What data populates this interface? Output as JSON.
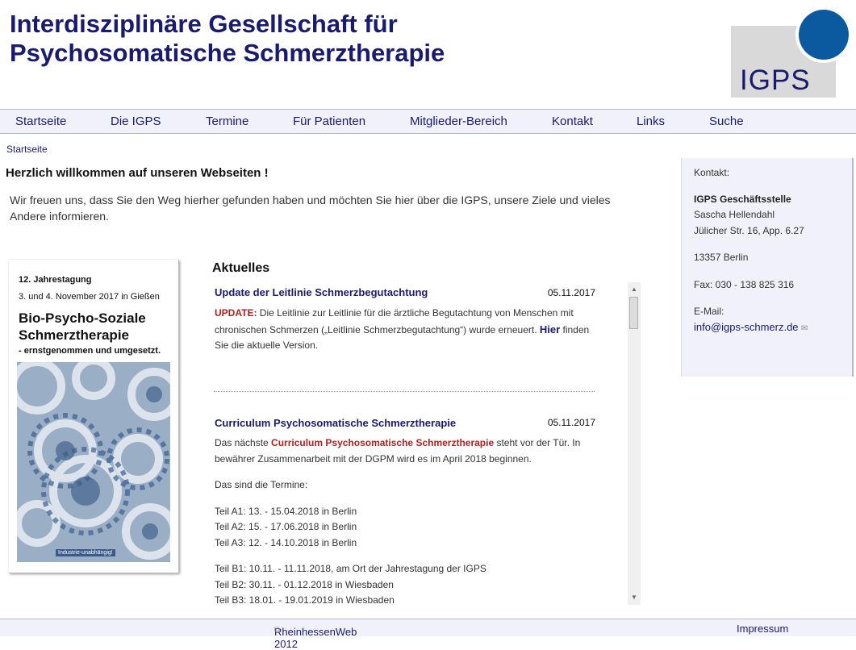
{
  "header": {
    "title_line1": "Interdisziplinäre Gesellschaft für",
    "title_line2": "Psychosomatische Schmerztherapie",
    "logo_text": "IGPS"
  },
  "nav": [
    "Startseite",
    "Die IGPS",
    "Termine",
    "Für Patienten",
    "Mitglieder-Bereich",
    "Kontakt",
    "Links",
    "Suche"
  ],
  "breadcrumb": "Startseite",
  "main": {
    "welcome": "Herzlich willkommen auf unseren Webseiten !",
    "intro_line1": "Wir freuen uns, dass Sie den Weg hierher gefunden haben und möchten Sie hier über die IGPS, unsere Ziele und vieles",
    "intro_line2": "Andere informieren."
  },
  "flyer": {
    "line1": "12. Jahrestagung",
    "line2": "3. und 4. November 2017 in Gießen",
    "line3a": "Bio-Psycho-Soziale",
    "line3b": "Schmerztherapie",
    "line4": "- ernstgenommen und umgesetzt.",
    "badge": "Industrie-unabhängig!"
  },
  "aktuelles": {
    "title": "Aktuelles",
    "item1": {
      "title": "Update der Leitlinie Schmerzbegutachtung",
      "date": "05.11.2017",
      "update_label": "UPDATE:",
      "text1": " Die Leitlinie zur Leitlinie für die ärztliche Begutachtung von Menschen mit",
      "text2": "chronischen Schmerzen („Leitlinie Schmerzbegutachtung“) wurde erneuert. ",
      "link": "Hier",
      "text3": " finden",
      "text4": "Sie die aktuelle Version."
    },
    "item2": {
      "title": "Curriculum Psychosomatische Schmerztherapie",
      "date": "05.11.2017",
      "text1a": "Das nächste ",
      "text1_red": "Curriculum Psychosomatische Schmerztherapie",
      "text1b": " steht vor der Tür. In",
      "text2": "bewährer Zusammenarbeit mit der DGPM wird es  im April 2018 beginnen.",
      "text3": "Das sind die Termine:",
      "a1": "Teil A1: 13. - 15.04.2018 in Berlin",
      "a2": "Teil A2: 15. - 17.06.2018 in Berlin",
      "a3": "Teil A3: 12. - 14.10.2018 in Berlin",
      "b1": "Teil B1: 10.11. - 11.11.2018,  am Ort der Jahrestagung der IGPS",
      "b2": "Teil B2: 30.11. - 01.12.2018 in Wiesbaden",
      "b3": "Teil B3: 18.01. - 19.01.2019 in Wiesbaden"
    }
  },
  "sidebar": {
    "label": "Kontakt:",
    "org": "IGPS Geschäftsstelle",
    "name": "Sascha Hellendahl",
    "street": "Jülicher Str. 16, App. 6.27",
    "city": "13357 Berlin",
    "fax": "Fax: 030 - 138 825 316",
    "email_label": "E-Mail:",
    "email": "info@igps-schmerz.de"
  },
  "footer": {
    "credit": "RheinhessenWeb 2012",
    "impressum": "Impressum"
  },
  "colors": {
    "navy": "#1a1a6e",
    "logo_blue": "#0b5aa0",
    "accent_red": "#b02020",
    "nav_bg": "#f1f1fb"
  }
}
